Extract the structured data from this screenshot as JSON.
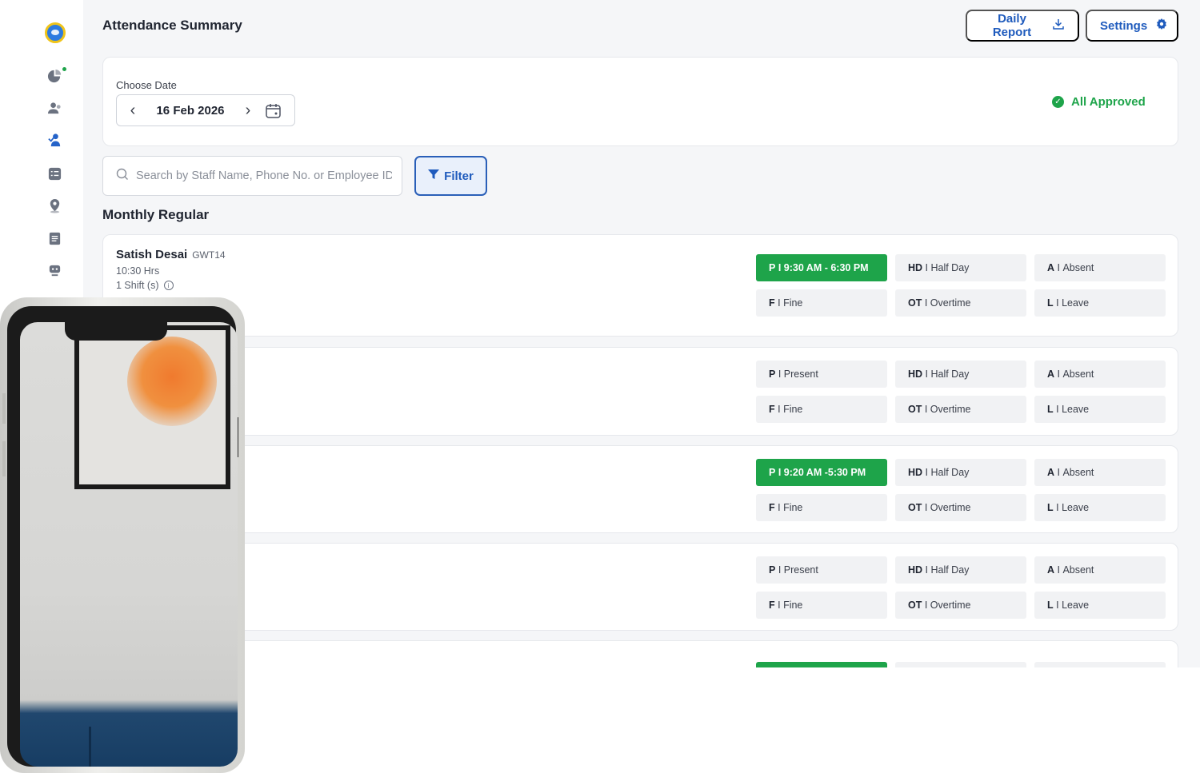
{
  "header": {
    "title": "Attendance Summary",
    "daily_report_label": "Daily Report",
    "settings_label": "Settings"
  },
  "date_section": {
    "label": "Choose Date",
    "date": "16 Feb 2026",
    "status": "All Approved"
  },
  "search": {
    "placeholder": "Search by Staff Name, Phone No. or Employee ID",
    "value": ""
  },
  "filter_label": "Filter",
  "section_title": "Monthly Regular",
  "legend": {
    "half_day": {
      "code": "HD",
      "text": "Half Day"
    },
    "absent": {
      "code": "A",
      "text": "Absent"
    },
    "fine": {
      "code": "F",
      "text": "Fine"
    },
    "overtime": {
      "code": "OT",
      "text": "Overtime"
    },
    "leave": {
      "code": "L",
      "text": "Leave"
    },
    "present": {
      "code": "P",
      "text": "Present"
    }
  },
  "staff": [
    {
      "name": "Satish Desai",
      "code": "GWT14",
      "hours": "10:30 Hrs",
      "shifts": "1 Shift (s)",
      "present_text": "9:30 AM - 6:30 PM",
      "present_active": true
    },
    {
      "present_text": "Present",
      "present_active": false
    },
    {
      "present_text": "9:20 AM -5:30 PM",
      "present_active": true
    },
    {
      "present_text": "Present",
      "present_active": false
    },
    {
      "present_text": "",
      "present_active": true
    }
  ],
  "colors": {
    "primary": "#1f5bbd",
    "success": "#1ea44a",
    "chip_bg": "#f1f2f4",
    "page_bg": "#f5f6f8"
  },
  "icons": {
    "sidebar": [
      "pie-chart-icon",
      "users-icon",
      "staff-attendance-icon",
      "checklist-icon",
      "location-icon",
      "document-icon",
      "support-icon"
    ],
    "daily_report": "download-icon",
    "settings": "gear-icon",
    "date_picker": "calendar-icon",
    "search": "search-icon",
    "filter": "filter-icon",
    "status": "check-circle-icon"
  }
}
